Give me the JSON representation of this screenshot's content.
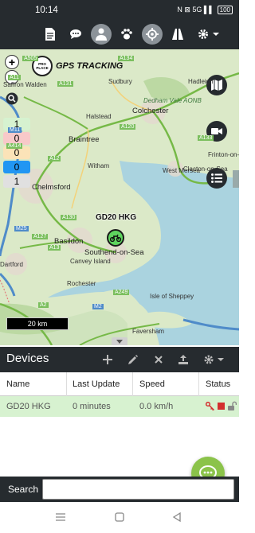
{
  "status_bar": {
    "time": "10:14",
    "indicators": "N ⊠ 5G ▌▌",
    "battery": "100"
  },
  "toolbar": {
    "icons": [
      "report-icon",
      "chat-icon",
      "user-icon",
      "paw-icon",
      "target-icon",
      "road-icon",
      "gear-icon"
    ],
    "active_icon": "user-icon"
  },
  "map": {
    "logo_text": "GPS TRACKING",
    "logo_badge": "PRO PLACE",
    "counts": [
      "1",
      "0",
      "0",
      "0",
      "1"
    ],
    "count_colors": [
      "#d6f2d0",
      "#f8c9c9",
      "#fbe3b8",
      "#2196f3",
      "#e0e0e0"
    ],
    "places": {
      "saffron_walden": "Saffron Walden",
      "sudbury": "Sudbury",
      "hadleigh": "Hadleigh",
      "halstead": "Halstead",
      "dedham_vale": "Dedham Vale AONB",
      "colchester": "Colchester",
      "braintree": "Braintree",
      "witham": "Witham",
      "west_mersea": "West Mersea",
      "clacton": "Clacton-on-Sea",
      "frinton": "Frinton-on-Sea",
      "chelmsford": "Chelmsford",
      "basildon": "Basildon",
      "southend": "Southend-on-Sea",
      "canvey": "Canvey Island",
      "dartford": "Dartford",
      "rochester": "Rochester",
      "isle_of_sheppey": "Isle of Sheppey",
      "faversham": "Faversham"
    },
    "roads": [
      "A131",
      "A134",
      "A12",
      "A120",
      "A133",
      "A414",
      "A127",
      "A13",
      "A130",
      "A249",
      "A2",
      "M25",
      "M2",
      "M11",
      "A11",
      "A505"
    ],
    "device_marker_label": "GD20 HKG",
    "scale": "20 km"
  },
  "devices": {
    "title": "Devices",
    "columns": [
      "Name",
      "Last Update",
      "Speed",
      "Status"
    ],
    "rows": [
      {
        "name": "GD20 HKG",
        "last_update": "0 minutes",
        "speed": "0.0 km/h"
      }
    ]
  },
  "search": {
    "label": "Search",
    "value": "",
    "placeholder": ""
  }
}
